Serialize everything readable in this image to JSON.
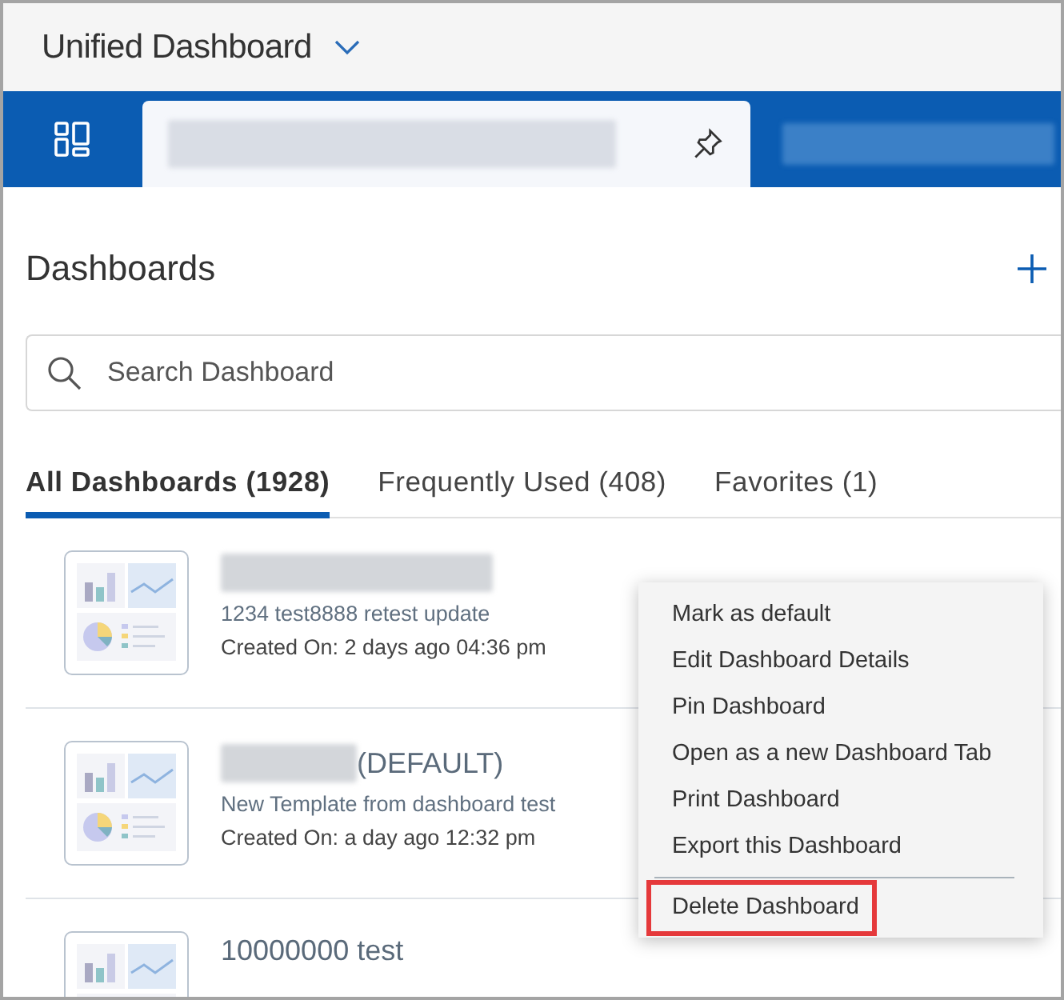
{
  "header": {
    "title": "Unified Dashboard"
  },
  "tab_bar": {
    "tabs": [
      {
        "kind": "home",
        "selected": false
      },
      {
        "kind": "redacted",
        "selected": true,
        "pinned": true
      },
      {
        "kind": "redacted",
        "selected": false
      }
    ]
  },
  "panel": {
    "title": "Dashboards",
    "search": {
      "placeholder": "Search Dashboard"
    },
    "tabs": [
      {
        "label": "All Dashboards (1928)",
        "selected": true
      },
      {
        "label": "Frequently Used (408)",
        "selected": false
      },
      {
        "label": "Favorites (1)",
        "selected": false
      }
    ],
    "dashboards": [
      {
        "title_redacted": true,
        "subtitle": "1234 test8888 retest update",
        "created": "Created On: 2 days ago 04:36 pm"
      },
      {
        "title_redacted": true,
        "title_suffix": "(DEFAULT)",
        "subtitle": "New Template from dashboard test",
        "created": "Created On: a day ago 12:32 pm"
      },
      {
        "title_redacted": false,
        "title_suffix": "10000000 test"
      }
    ]
  },
  "context_menu": {
    "items": [
      {
        "label": "Mark as default",
        "divider_before": false,
        "highlighted": false
      },
      {
        "label": "Edit Dashboard Details",
        "divider_before": false,
        "highlighted": false
      },
      {
        "label": "Pin Dashboard",
        "divider_before": false,
        "highlighted": false
      },
      {
        "label": "Open as a new Dashboard Tab",
        "divider_before": false,
        "highlighted": false
      },
      {
        "label": "Print Dashboard",
        "divider_before": false,
        "highlighted": false
      },
      {
        "label": "Export this Dashboard",
        "divider_before": false,
        "highlighted": false
      },
      {
        "label": "Delete Dashboard",
        "divider_before": true,
        "highlighted": true
      }
    ]
  }
}
